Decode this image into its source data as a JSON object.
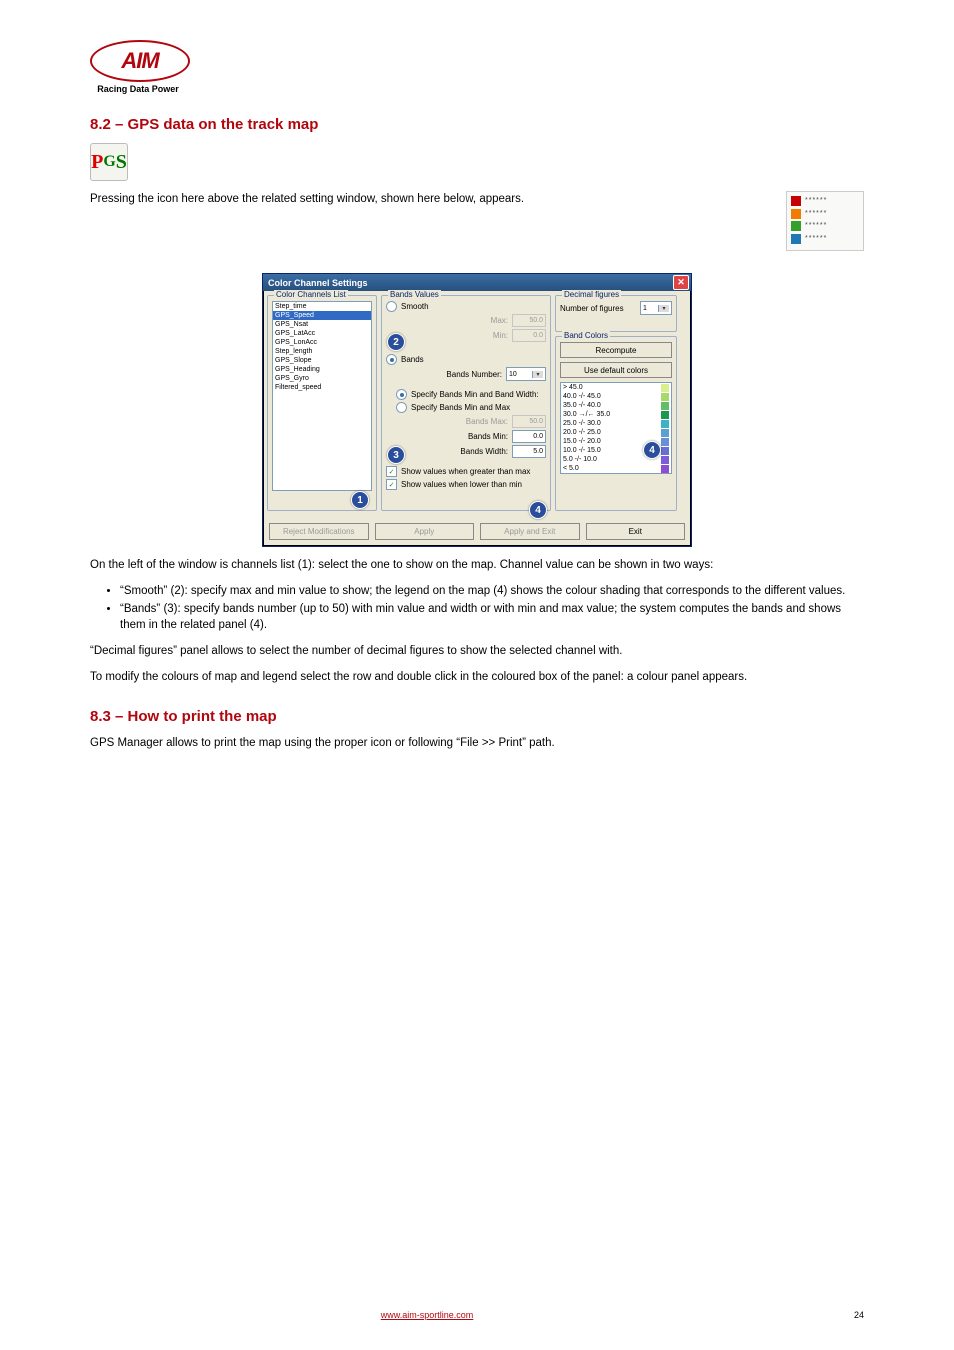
{
  "logo": {
    "brand": "AIM",
    "tagline": "Racing Data Power"
  },
  "heading1": "8.2 – GPS data on the track map",
  "icon_label": {
    "p": "P",
    "g": "G",
    "s": "S"
  },
  "para1": "Pressing the icon here above the related setting window, shown here below, appears.",
  "legend_colors": [
    "#c70000",
    "#f07d00",
    "#33a02c",
    "#1f78b4"
  ],
  "dialog": {
    "title": "Color Channel Settings",
    "groups": {
      "channels": "Color Channels List",
      "bands": "Bands Values",
      "decimals": "Decimal figures",
      "colors": "Band Colors"
    },
    "channel_items": [
      "Step_time",
      "GPS_Speed",
      "GPS_Nsat",
      "GPS_LatAcc",
      "GPS_LonAcc",
      "Step_length",
      "GPS_Slope",
      "GPS_Heading",
      "GPS_Gyro",
      "Filtered_speed"
    ],
    "selected_channel": "GPS_Speed",
    "smooth_label": "Smooth",
    "max_label": "Max:",
    "max_value": "50.0",
    "min_label": "Min:",
    "min_value": "0.0",
    "bands_label": "Bands",
    "bands_number_label": "Bands Number:",
    "bands_number_value": "10",
    "spec_min_width_label": "Specify Bands Min and Band Width:",
    "spec_min_max_label": "Specify Bands Min and Max",
    "bands_max_label": "Bands Max:",
    "bands_max_value": "50.0",
    "bands_min_label": "Bands Min:",
    "bands_min_value": "0.0",
    "bands_width_label": "Bands Width:",
    "bands_width_value": "5.0",
    "chk_greater": "Show values when greater than max",
    "chk_lower": "Show values when lower than min",
    "num_fig_label": "Number of figures",
    "num_fig_value": "1",
    "recompute_btn": "Recompute",
    "default_colors_btn": "Use default colors",
    "color_rows": [
      {
        "t": "> 45.0",
        "c": "#d9ef8b"
      },
      {
        "t": "40.0  -/- 45.0",
        "c": "#a6d96a"
      },
      {
        "t": "35.0  -/- 40.0",
        "c": "#66bd63"
      },
      {
        "t": "30.0  →/← 35.0",
        "c": "#1a9850"
      },
      {
        "t": "25.0  -/- 30.0",
        "c": "#3fb1c6"
      },
      {
        "t": "20.0  -/- 25.0",
        "c": "#5aa0d0"
      },
      {
        "t": "15.0  -/- 20.0",
        "c": "#6a8fd6"
      },
      {
        "t": "10.0  -/- 15.0",
        "c": "#6a6fd6"
      },
      {
        "t": "5.0   -/- 10.0",
        "c": "#7a5fd6"
      },
      {
        "t": "< 5.0",
        "c": "#8a4fd6"
      }
    ],
    "buttons": {
      "reject": "Reject Modifications",
      "apply": "Apply",
      "apply_exit": "Apply and Exit",
      "exit": "Exit"
    }
  },
  "badges": {
    "b1": "1",
    "b2": "2",
    "b3": "3",
    "b4a": "4",
    "b4b": "4"
  },
  "para2": "On the left of the window is channels list (1): select the one to show on the map. Channel value can be shown in two ways:",
  "bullets": [
    "“Smooth” (2): specify max and min value to show; the legend on the map (4) shows the colour shading that corresponds to the different values.",
    "“Bands” (3): specify bands number (up to 50) with min value and width or with min and max value; the system computes the bands and shows them in the related panel (4)."
  ],
  "para3": "“Decimal figures” panel allows to select the number of decimal figures to show the selected channel with.",
  "para4": "To modify the colours of map and legend select the row and double click in the coloured box of the panel: a colour panel appears.",
  "heading2": "8.3 – How to print the map",
  "para5": "GPS Manager allows to print the map using the proper icon or following “File >> Print” path.",
  "footer": {
    "link": "www.aim-sportline.com",
    "page": "24"
  }
}
